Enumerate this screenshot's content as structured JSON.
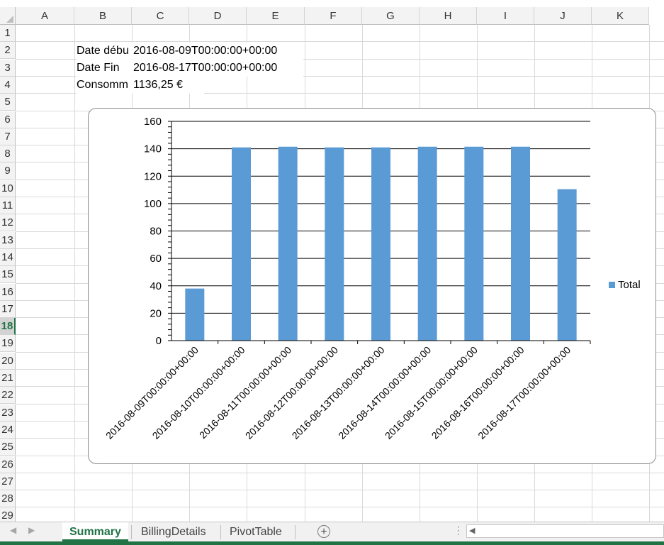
{
  "columns": [
    "A",
    "B",
    "C",
    "D",
    "E",
    "F",
    "G",
    "H",
    "I",
    "J",
    "K"
  ],
  "rows": [
    "1",
    "2",
    "3",
    "4",
    "5",
    "6",
    "7",
    "8",
    "9",
    "10",
    "11",
    "12",
    "13",
    "14",
    "15",
    "16",
    "17",
    "18",
    "19",
    "20",
    "21",
    "22",
    "23",
    "24",
    "25",
    "26",
    "27",
    "28",
    "29"
  ],
  "selected_row": "18",
  "cells": {
    "b2": "Date débu",
    "c2": "2016-08-09T00:00:00+00:00",
    "b3": "Date Fin",
    "c3": "2016-08-17T00:00:00+00:00",
    "b4": "Consomm",
    "c4": "1136,25 €"
  },
  "chart_data": {
    "type": "bar",
    "categories": [
      "2016-08-09T00:00:00+00:00",
      "2016-08-10T00:00:00+00:00",
      "2016-08-11T00:00:00+00:00",
      "2016-08-12T00:00:00+00:00",
      "2016-08-13T00:00:00+00:00",
      "2016-08-14T00:00:00+00:00",
      "2016-08-15T00:00:00+00:00",
      "2016-08-16T00:00:00+00:00",
      "2016-08-17T00:00:00+00:00"
    ],
    "series": [
      {
        "name": "Total",
        "values": [
          38,
          141,
          141.5,
          141,
          141,
          141.5,
          141.5,
          141.5,
          110.5
        ],
        "color": "#5b9bd5"
      }
    ],
    "yticks": [
      "0",
      "20",
      "40",
      "60",
      "80",
      "100",
      "120",
      "140",
      "160"
    ],
    "ylim": [
      0,
      160
    ],
    "grid": true,
    "legend_position": "right"
  },
  "tabs": [
    {
      "label": "Summary",
      "active": true
    },
    {
      "label": "BillingDetails",
      "active": false
    },
    {
      "label": "PivotTable",
      "active": false
    }
  ],
  "tabbar": {
    "prev_icon": "◀",
    "next_icon": "▶",
    "add_icon": "+",
    "dots": "⋮",
    "scroll_left_icon": "◀"
  }
}
